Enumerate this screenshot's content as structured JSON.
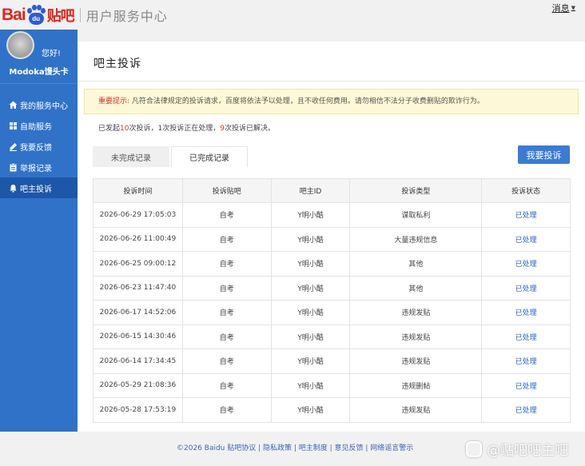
{
  "header": {
    "logo_bai": "Bai",
    "logo_du": "du",
    "logo_tieba": "贴吧",
    "site_title": "用户服务中心",
    "messages_label": "消息"
  },
  "user": {
    "greeting": "您好!",
    "name": "Modoka馒头卡"
  },
  "sidebar": {
    "items": [
      {
        "label": "我的服务中心",
        "icon": "home-icon"
      },
      {
        "label": "自助服务",
        "icon": "grid-icon"
      },
      {
        "label": "我要反馈",
        "icon": "pencil-icon"
      },
      {
        "label": "举报记录",
        "icon": "clipboard-icon"
      },
      {
        "label": "吧主投诉",
        "icon": "megaphone-icon"
      }
    ],
    "active_index": 4
  },
  "main": {
    "title": "吧主投诉",
    "notice_lead": "重要提示:",
    "notice_text": "凡符合法律规定的投诉请求，百度将依法予以处理，且不收任何费用。请勿相信不法分子收费删贴的欺诈行为。",
    "summary": {
      "part1": "已发起",
      "total": "10",
      "part2": "次投诉，1次投诉正在处理，",
      "resolved": "9",
      "part3": "次投诉已解决。"
    },
    "tabs": [
      {
        "label": "未完成记录"
      },
      {
        "label": "已完成记录"
      }
    ],
    "active_tab": 1,
    "complain_button": "我要投诉"
  },
  "table": {
    "headers": [
      "投诉时间",
      "投诉贴吧",
      "吧主ID",
      "投诉类型",
      "投诉状态"
    ],
    "rows": [
      [
        "2026-06-29 17:05:03",
        "自考",
        "Y明小酷",
        "谋取私利",
        "已处理"
      ],
      [
        "2026-06-26 11:00:49",
        "自考",
        "Y明小酷",
        "大量违规信息",
        "已处理"
      ],
      [
        "2026-06-25 09:00:12",
        "自考",
        "Y明小酷",
        "其他",
        "已处理"
      ],
      [
        "2026-06-23 11:47:40",
        "自考",
        "Y明小酷",
        "其他",
        "已处理"
      ],
      [
        "2026-06-17 14:52:06",
        "自考",
        "Y明小酷",
        "违规发贴",
        "已处理"
      ],
      [
        "2026-06-15 14:30:46",
        "自考",
        "Y明小酷",
        "违规发贴",
        "已处理"
      ],
      [
        "2026-06-14 17:34:45",
        "自考",
        "Y明小酷",
        "违规发贴",
        "已处理"
      ],
      [
        "2026-05-29 21:08:36",
        "自考",
        "Y明小酷",
        "违规删帖",
        "已处理"
      ],
      [
        "2026-05-28 17:53:19",
        "自考",
        "Y明小酷",
        "违规发贴",
        "已处理"
      ]
    ]
  },
  "footer": {
    "text": "©2026 Baidu 贴吧协议 | 隐私政策 | 吧主制度 | 意见反馈 | 网络谣言警示",
    "watermark": "@贴吧吧主吧"
  }
}
